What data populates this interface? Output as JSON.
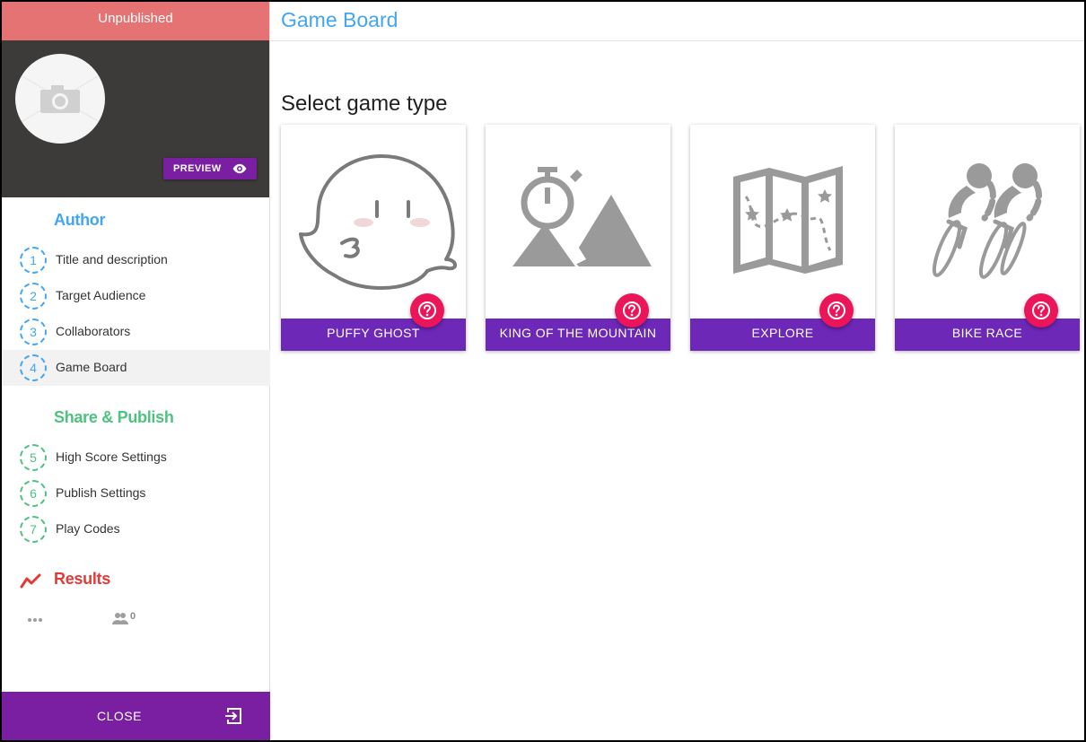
{
  "status": {
    "label": "Unpublished",
    "color": "#e57373"
  },
  "header": {
    "title": "Game Board"
  },
  "cover": {
    "preview_label": "PREVIEW",
    "avatar_icon": "camera-icon",
    "preview_icon": "eye-icon"
  },
  "sidebar": {
    "author_title": "Author",
    "author_steps": [
      {
        "num": "1",
        "label": "Title and description"
      },
      {
        "num": "2",
        "label": "Target Audience"
      },
      {
        "num": "3",
        "label": "Collaborators"
      },
      {
        "num": "4",
        "label": "Game Board",
        "active": true
      }
    ],
    "share_title": "Share & Publish",
    "share_steps": [
      {
        "num": "5",
        "label": "High Score Settings"
      },
      {
        "num": "6",
        "label": "Publish Settings"
      },
      {
        "num": "7",
        "label": "Play Codes"
      }
    ],
    "results_title": "Results",
    "players_count": "0",
    "close_label": "CLOSE"
  },
  "main": {
    "heading": "Select game type",
    "cards": [
      {
        "label": "PUFFY GHOST",
        "icon": "ghost-icon"
      },
      {
        "label": "KING OF THE MOUNTAIN",
        "icon": "mountain-stopwatch-icon"
      },
      {
        "label": "EXPLORE",
        "icon": "treasure-map-icon"
      },
      {
        "label": "BIKE RACE",
        "icon": "cyclists-icon"
      }
    ]
  },
  "colors": {
    "accent_blue": "#42a5f5",
    "accent_green": "#4ec27f",
    "accent_red": "#e53935",
    "purple": "#7b1fa2",
    "card_bar": "#6d28b8",
    "help_pink": "#ec1559"
  }
}
